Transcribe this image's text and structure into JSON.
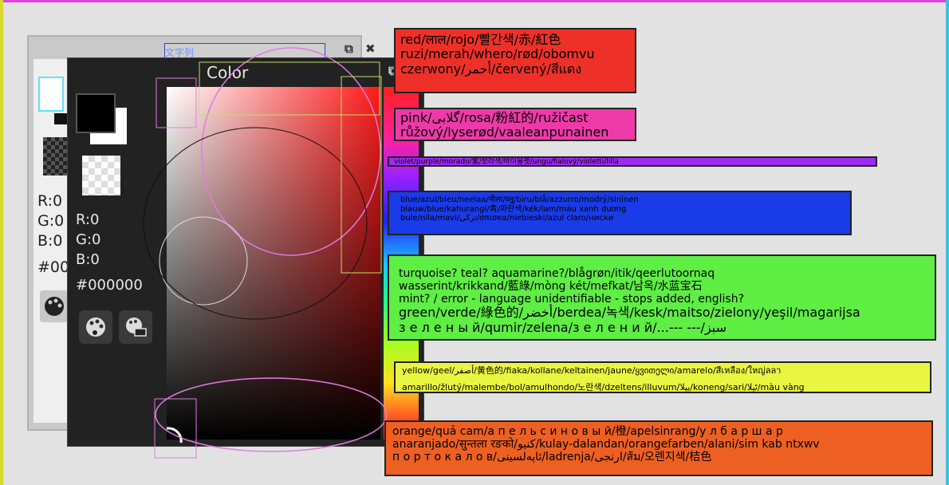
{
  "back_panel": {
    "title": "文字列",
    "rgb": [
      "R:0",
      "G:0",
      "B:0"
    ],
    "hex": "#00"
  },
  "panel": {
    "title": "Color",
    "rgb": [
      "R:0",
      "G:0",
      "B:0"
    ],
    "hex": "#000000",
    "controls": {
      "popout": "⧉",
      "close": "✖"
    }
  },
  "bands": {
    "red": {
      "lines": [
        "red/लाल/rojo/빨간색/赤/紅色",
        "ruzi/merah/whero/rød/obomvu",
        "czerwony/أحمر/červený/สีแดง"
      ],
      "color": "#ee3128"
    },
    "pink": {
      "lines": [
        "pink/گلابی/rosa/粉紅的/ružičast",
        "růžový/lyserød/vaaleanpunainen"
      ],
      "color": "#ee3aa9"
    },
    "violet": {
      "lines": [
        "violet/purple/morado/紫/보라색/바이올렛/ungu/fialový/violetti/lilla"
      ],
      "color": "#9f2bf2"
    },
    "blue": {
      "lines": [
        "blue/azul/bleu/neelaa/नीला/ब्लू/biru/blå/azzurro/modrý/sininen",
        "blauw/blue/kahurangi/青/파란색/kék/lam/màu xanh dương",
        "bule/nila/mavi/ترکی/σπισκα/niebieski/azul claro/ниски"
      ],
      "color": "#1a3be8"
    },
    "green": {
      "lines": [
        "turquoise? teal? aquamarine?/blågrøn/itik/qeerlutoornaq",
        "wasserint/krikkand/藍綠/mòng két/mefkat/남옥/水蓝宝石",
        "mint? / error - language unidentifiable - stops added, english?",
        "green/verde/綠色的/أخضر/berdea/녹색/kesk/maitso/zielony/yeşil/magarijsa",
        "з е л е н ы й/qumir/zelena/з е л е н и й/...--- ---/سبز"
      ],
      "color": "#5eee44"
    },
    "yellow": {
      "lines": [
        "yellow/geel/أصفر/黄色的/fiaka/kollane/keltainen/jaune/ყვითელი/amarelo/สีเหลือง/ใหญ่ลลา",
        "amarillo/žlutý/malembe/bol/amulhondo/노란색/dzeltens/illuvum/پیلا/koneng/sari/ٹیلا/màu vàng"
      ],
      "color": "#eaf541"
    },
    "orange": {
      "lines": [
        "orange/quả cam/а п е л ь с и н о в ы й/橙/apelsinrang/у л б а р ш а р",
        "anaranjado/सुन्तला रङको/کنیو/kulay-dalandan/orangefarben/alani/sim kab ntxwv",
        "п о р т о к а л о в/ئاپەلسینی/ladrenja/ارنجی/ส้ม/오렌지색/桔色"
      ],
      "color": "#ee6022"
    }
  }
}
